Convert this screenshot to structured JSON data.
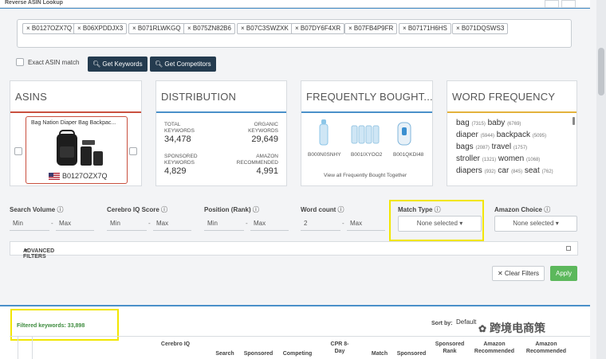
{
  "header": {
    "title": "Reverse ASIN Lookup"
  },
  "asin_chips": [
    "B0127OZX7Q",
    "B06XPDDJX3",
    "B071RLWKGQ",
    "B075ZN82B6",
    "B07C3SWZXK",
    "B07DY6F4XR",
    "B07FB4P9FR",
    "B07171H6HS",
    "B071DQSWS3"
  ],
  "controls": {
    "exact_match_label": "Exact ASIN match",
    "get_keywords_label": "Get Keywords",
    "get_competitors_label": "Get Competitors"
  },
  "cards": {
    "asins": {
      "title": "ASINS",
      "product_title": "Bag Nation Diaper Bag Backpac...",
      "product_asin": "B0127OZX7Q"
    },
    "distribution": {
      "title": "DISTRIBUTION",
      "total_label": "TOTAL\nKEYWORDS",
      "total_value": "34,478",
      "organic_label": "ORGANIC\nKEYWORDS",
      "organic_value": "29,649",
      "sponsored_label": "SPONSORED\nKEYWORDS",
      "sponsored_value": "4,829",
      "amazon_label": "AMAZON\nRECOMMENDED",
      "amazon_value": "4,991"
    },
    "fbt": {
      "title": "FREQUENTLY BOUGHT...",
      "items": [
        "B000N0SNHY",
        "B001IXYOO2",
        "B001QKDI48"
      ],
      "link": "View all Frequently Bought Together"
    },
    "word_freq": {
      "title": "WORD FREQUENCY",
      "rows": [
        [
          {
            "w": "bag",
            "n": "(7315)"
          },
          {
            "w": "baby",
            "n": "(6769)"
          }
        ],
        [
          {
            "w": "diaper",
            "n": "(5944)"
          },
          {
            "w": "backpack",
            "n": "(5095)"
          }
        ],
        [
          {
            "w": "bags",
            "n": "(2087)"
          },
          {
            "w": "travel",
            "n": "(1757)"
          }
        ],
        [
          {
            "w": "stroller",
            "n": "(1321)"
          },
          {
            "w": "women",
            "n": "(1068)"
          }
        ],
        [
          {
            "w": "diapers",
            "n": "(932)"
          },
          {
            "w": "car",
            "n": "(845)"
          },
          {
            "w": "seat",
            "n": "(762)"
          }
        ]
      ]
    }
  },
  "filters": {
    "search_volume": {
      "label": "Search Volume",
      "min": "Min",
      "max": "Max"
    },
    "cerebro_iq": {
      "label": "Cerebro IQ Score",
      "min": "Min",
      "max": "Max"
    },
    "position": {
      "label": "Position (Rank)",
      "min": "Min",
      "max": "Max"
    },
    "word_count": {
      "label": "Word count",
      "min": "2",
      "max": "Max"
    },
    "match_type": {
      "label": "Match Type",
      "value": "None selected"
    },
    "amazon_choice": {
      "label": "Amazon Choice",
      "value": "None selected"
    },
    "advanced_label": "ADVANCED FILTERS",
    "clear_label": "Clear Filters",
    "apply_label": "Apply",
    "dash": "-"
  },
  "results": {
    "filtered_text": "Filtered keywords: 33,898",
    "sort_label": "Sort by:",
    "sort_value": "Default",
    "columns": [
      "Cerebro IQ",
      "Search",
      "Sponsored",
      "Competing",
      "CPR 8-Day",
      "Match",
      "Sponsored",
      "Sponsored Rank",
      "Amazon Recommended",
      "Amazon Recommended"
    ]
  },
  "watermark": "跨境电商策",
  "colors": {
    "accent": "#4a90c9",
    "dark_button": "#243b4f",
    "apply": "#5cb85c",
    "highlight": "#f2e600"
  }
}
